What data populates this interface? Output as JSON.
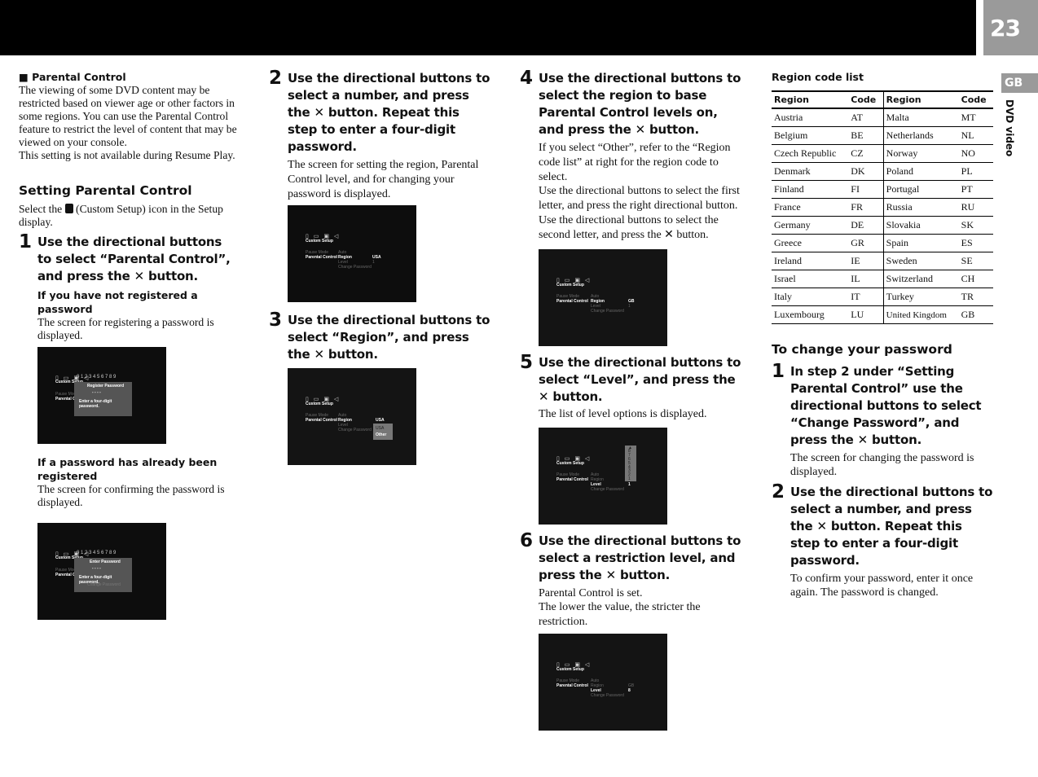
{
  "header": {
    "page_number": "23",
    "lang_tab": "GB",
    "section_label": "DVD video"
  },
  "col1": {
    "heading": "■ Parental Control",
    "intro": "The viewing of some DVD content may be restricted based on viewer age or other factors in some regions. You can use the Parental Control feature to restrict the level of content that may be viewed on your console.",
    "intro2": "This setting is not available during Resume Play.",
    "section_title": "Setting Parental Control",
    "select_pre": "Select the",
    "select_post": "(Custom Setup) icon in the Setup display.",
    "step1": {
      "num": "1",
      "title": "Use the directional buttons to select “Parental Control”, and press the ✕ button."
    },
    "sub1": {
      "title": "If you have not registered a password",
      "text": "The screen for registering a password is displayed."
    },
    "sub2": {
      "title": "If a password has already been registered",
      "text": "The screen for confirming the password is displayed."
    }
  },
  "col2": {
    "step2": {
      "num": "2",
      "title": "Use the directional buttons to select a number, and press the ✕ button. Repeat this step to enter a four-digit password.",
      "text": "The screen for setting the region, Parental Control level, and for changing your password is displayed."
    },
    "step3": {
      "num": "3",
      "title": "Use the directional buttons to select “Region”, and press the ✕ button."
    }
  },
  "col3": {
    "step4": {
      "num": "4",
      "title": "Use the directional buttons to select the region to base Parental Control levels on, and press the ✕ button.",
      "text1": "If you select “Other”, refer to the “Region code list” at right for the region code to select.",
      "text2": "Use the directional buttons to select the first letter, and press the right directional button. Use the directional buttons to select the second letter, and press the ✕ button."
    },
    "step5": {
      "num": "5",
      "title": "Use the directional buttons to select “Level”, and press the ✕ button.",
      "text": "The list of level options is displayed."
    },
    "step6": {
      "num": "6",
      "title": "Use the directional buttons to select a restriction level, and press the ✕ button.",
      "text1": "Parental Control is set.",
      "text2": "The lower the value, the stricter the restriction."
    }
  },
  "col4": {
    "table_title": "Region code list",
    "headers": [
      "Region",
      "Code",
      "Region",
      "Code"
    ],
    "rows": [
      [
        "Austria",
        "AT",
        "Malta",
        "MT"
      ],
      [
        "Belgium",
        "BE",
        "Netherlands",
        "NL"
      ],
      [
        "Czech Republic",
        "CZ",
        "Norway",
        "NO"
      ],
      [
        "Denmark",
        "DK",
        "Poland",
        "PL"
      ],
      [
        "Finland",
        "FI",
        "Portugal",
        "PT"
      ],
      [
        "France",
        "FR",
        "Russia",
        "RU"
      ],
      [
        "Germany",
        "DE",
        "Slovakia",
        "SK"
      ],
      [
        "Greece",
        "GR",
        "Spain",
        "ES"
      ],
      [
        "Ireland",
        "IE",
        "Sweden",
        "SE"
      ],
      [
        "Israel",
        "IL",
        "Switzerland",
        "CH"
      ],
      [
        "Italy",
        "IT",
        "Turkey",
        "TR"
      ],
      [
        "Luxembourg",
        "LU",
        "United Kingdom",
        "GB"
      ]
    ],
    "change_title": "To change your password",
    "cstep1": {
      "num": "1",
      "title": "In step 2 under “Setting Parental Control” use the directional buttons to select “Change Password”, and press the ✕ button.",
      "text": "The screen for changing the password is displayed."
    },
    "cstep2": {
      "num": "2",
      "title": "Use the directional buttons to select a number, and press the ✕ button. Repeat this step to enter a four-digit password.",
      "text": "To confirm your password, enter it once again. The password is changed."
    }
  },
  "screens": {
    "icons": "▯ ▭ ▣ ◁",
    "title": "Custom Setup",
    "pause_mode": "Pause Mode",
    "auto": "Auto",
    "parental_control": "Parental Control",
    "region": "Region",
    "level": "Level",
    "change_password": "Change Password",
    "digits": "0 1 2 3 4 5 6 7 8 9",
    "register_password": "Register Password",
    "enter_password": "Enter Password",
    "enter_prompt": "Enter a four-digit password.",
    "dots": "- - - -",
    "usa": "USA",
    "gb": "GB",
    "level_1": "1",
    "level_8": "8",
    "other": "Other",
    "level_list": "▲ 8 7 6 5 4 3 2 1"
  }
}
